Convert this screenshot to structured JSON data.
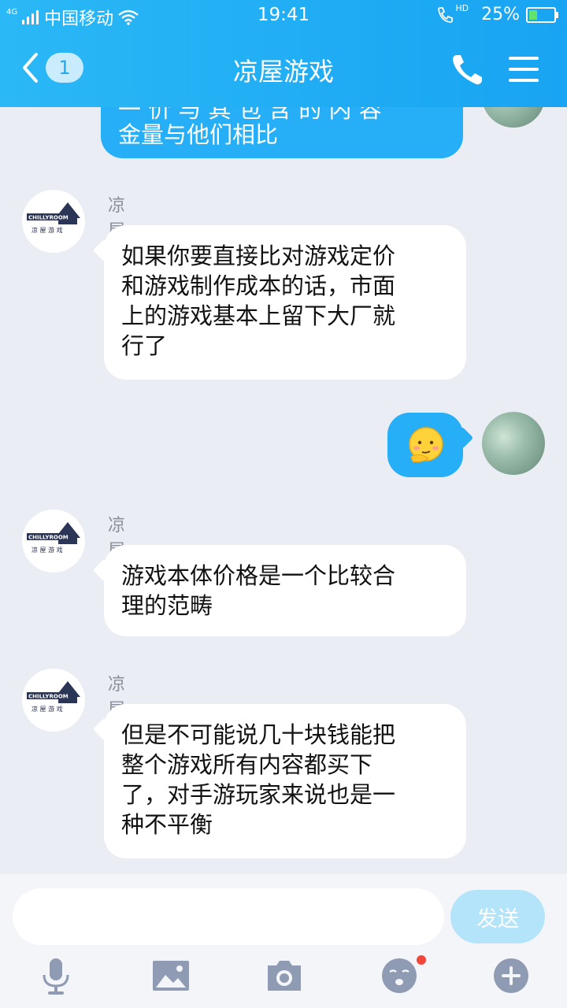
{
  "status": {
    "carrier": "中国移动",
    "time": "19:41",
    "battery": "25%",
    "network": "4G",
    "hd": "HD"
  },
  "header": {
    "title": "凉屋游戏",
    "unread": "1"
  },
  "chat": {
    "sender_name": "凉屋游戏",
    "avatar_brand": "CHILLYROOM",
    "avatar_brand_cn": "凉 屋 游 戏",
    "messages": [
      {
        "from": "me",
        "lines": [
          "一 价 与 其 包 含 的 内 容",
          "金量与他们相比"
        ]
      },
      {
        "from": "other",
        "name": "凉屋游戏",
        "lines": [
          "如果你要直接比对游戏定价",
          "和游戏制作成本的话，市面",
          "上的游戏基本上留下大厂就",
          "行了"
        ]
      },
      {
        "from": "me",
        "emoji": "thinking-face"
      },
      {
        "from": "other",
        "name": "凉屋游戏",
        "lines": [
          "游戏本体价格是一个比较合",
          "理的范畴"
        ]
      },
      {
        "from": "other",
        "name": "凉屋游戏",
        "lines": [
          "但是不可能说几十块钱能把",
          "整个游戏所有内容都买下",
          "了，对手游玩家来说也是一",
          "种不平衡"
        ]
      }
    ]
  },
  "input": {
    "placeholder": "",
    "send_label": "发送"
  },
  "toolbar": [
    "mic-icon",
    "image-icon",
    "camera-icon",
    "emoji-icon",
    "plus-icon"
  ],
  "colors": {
    "header": "#1fa9f4",
    "bubble_me": "#26aff6",
    "background": "#ebedf5"
  }
}
